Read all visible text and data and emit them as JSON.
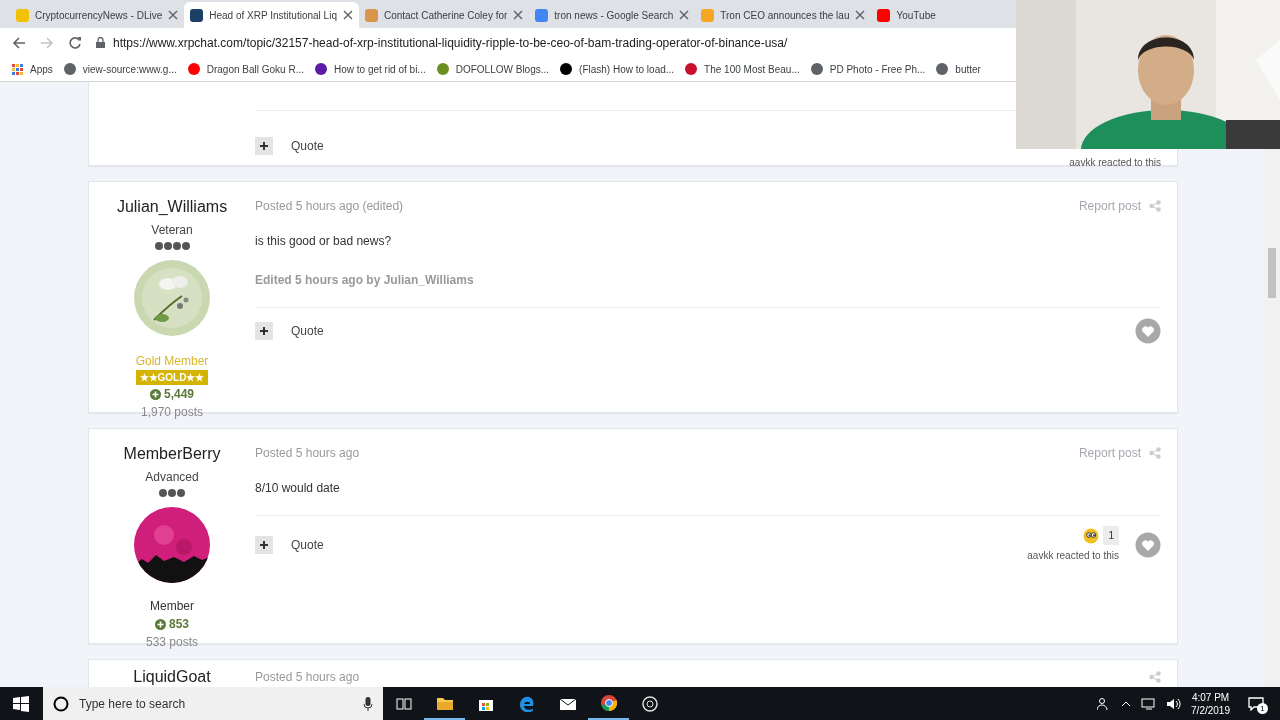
{
  "browser": {
    "tabs": [
      {
        "title": "CryptocurrencyNews - DLive",
        "selected": false
      },
      {
        "title": "Head of XRP Institutional Liq",
        "selected": true
      },
      {
        "title": "Contact Catherine Coley for",
        "selected": false
      },
      {
        "title": "tron news - Google Search",
        "selected": false
      },
      {
        "title": "Tron CEO announces the lau",
        "selected": false
      },
      {
        "title": "YouTube",
        "selected": false
      }
    ],
    "url": "https://www.xrpchat.com/topic/32157-head-of-xrp-institutional-liquidity-ripple-to-be-ceo-of-bam-trading-operator-of-binance-usa/",
    "bookmarks": [
      {
        "label": "Apps"
      },
      {
        "label": "view-source:www.g..."
      },
      {
        "label": "Dragon Ball Goku R..."
      },
      {
        "label": "How to get rid of bi..."
      },
      {
        "label": "DOFOLLOW Blogs..."
      },
      {
        "label": "(Flash) How to load..."
      },
      {
        "label": "The 100 Most Beau..."
      },
      {
        "label": "PD Photo - Free Ph..."
      },
      {
        "label": "butter"
      }
    ]
  },
  "posts": [
    {
      "kind": "partial",
      "quote": "Quote",
      "reaction_note": "aavkk reacted to this"
    },
    {
      "kind": "full",
      "author": "Julian_Williams",
      "rank": "Veteran",
      "stars": 4,
      "group": "Gold Member",
      "group_badge": "★★GOLD★★",
      "reputation": "5,449",
      "post_count": "1,970 posts",
      "posted": "Posted 5 hours ago (edited)",
      "report": "Report post",
      "content": "is this good or bad news?",
      "edited": "Edited 5 hours ago by Julian_Williams",
      "quote": "Quote"
    },
    {
      "kind": "full",
      "author": "MemberBerry",
      "rank": "Advanced",
      "stars": 3,
      "group": "Member",
      "reputation": "853",
      "post_count": "533 posts",
      "posted": "Posted 5 hours ago",
      "report": "Report post",
      "content": "8/10 would date",
      "quote": "Quote",
      "reaction_count": "1",
      "reaction_note": "aavkk reacted to this"
    },
    {
      "kind": "cut",
      "author": "LiquidGoat",
      "posted": "Posted 5 hours ago"
    }
  ],
  "taskbar": {
    "search_placeholder": "Type here to search",
    "time": "4:07 PM",
    "date": "7/2/2019",
    "notification_count": "1"
  }
}
